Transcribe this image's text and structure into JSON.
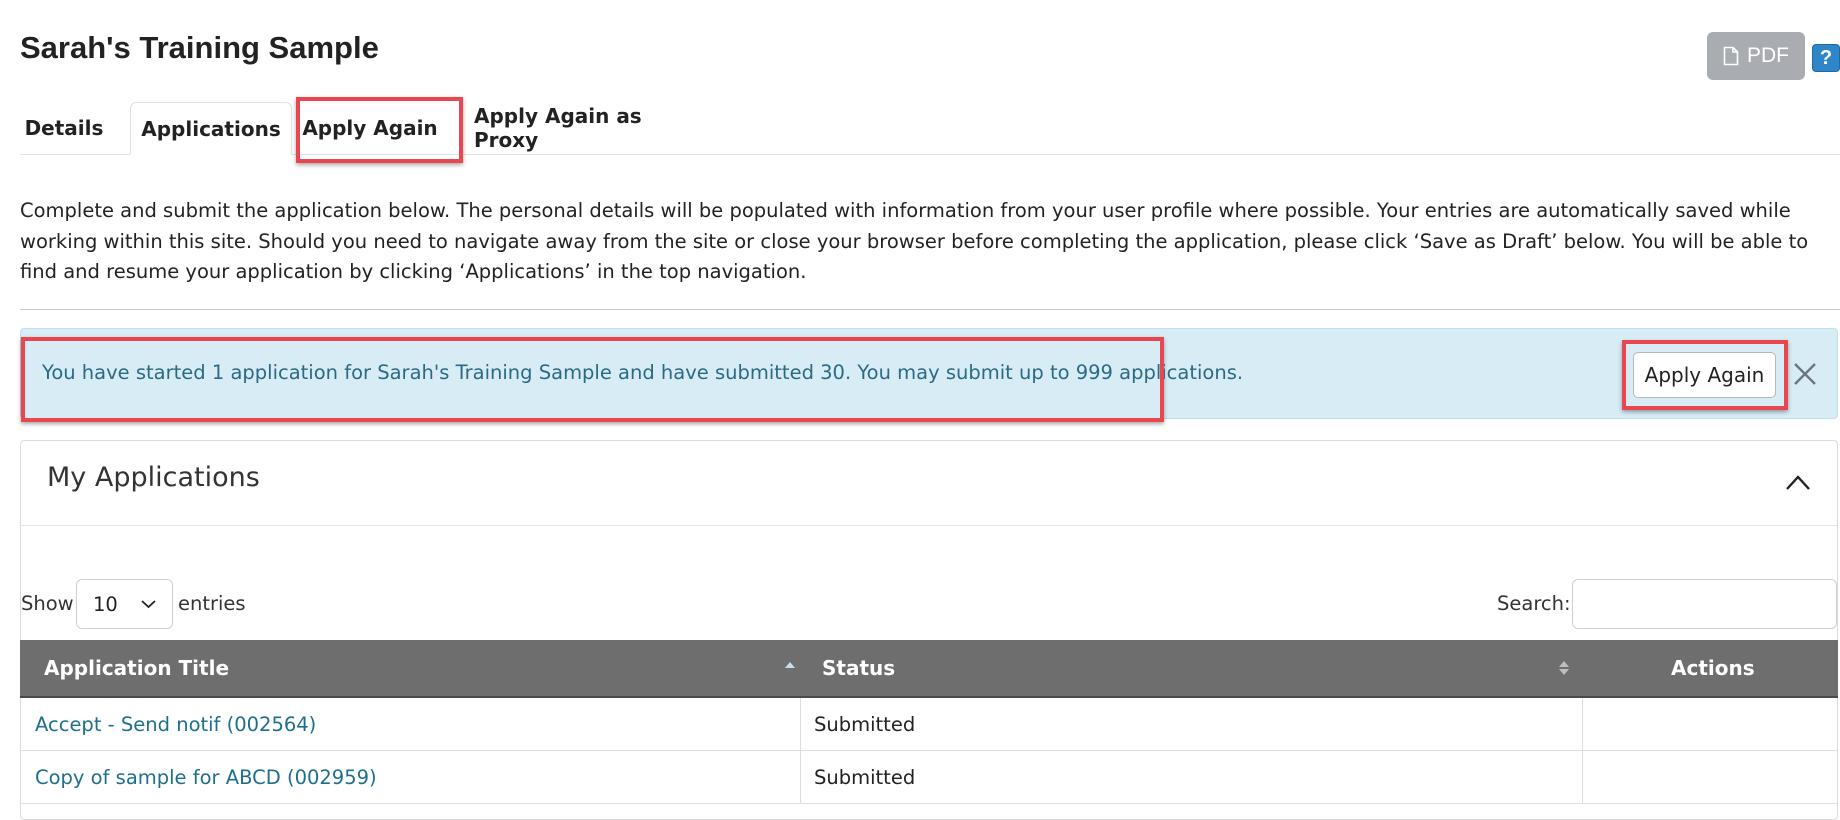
{
  "page": {
    "title": "Sarah's Training Sample",
    "pdf_label": "PDF",
    "help_label": "?"
  },
  "tabs": [
    {
      "label": "Details",
      "active": false
    },
    {
      "label": "Applications",
      "active": true
    },
    {
      "label": "Apply Again",
      "active": false,
      "highlighted": true
    },
    {
      "label": "Apply Again as Proxy",
      "active": false
    }
  ],
  "intro": {
    "text": "Complete and submit the application below. The personal details will be populated with information from your user profile where possible. Your entries are automatically saved while working within this site. Should you need to navigate away from the site or close your browser before completing the application, please click ‘Save as Draft’ below. You will be able to find and resume your application by clicking ‘Applications’ in the top navigation."
  },
  "alert": {
    "message": "You have started 1 application for Sarah's Training Sample and have submitted 30. You may submit up to 999 applications.",
    "button_label": "Apply Again",
    "highlighted": true
  },
  "panel": {
    "title": "My Applications",
    "show_label": "Show",
    "entries_label": "entries",
    "page_length": "10",
    "search_label": "Search:",
    "search_value": ""
  },
  "table": {
    "columns": [
      "Application Title",
      "Status",
      "Actions"
    ],
    "rows": [
      {
        "title": "Accept - Send notif (002564)",
        "status": "Submitted",
        "actions": ""
      },
      {
        "title": "Copy of sample for ABCD (002959)",
        "status": "Submitted",
        "actions": ""
      }
    ]
  },
  "colors": {
    "highlight": "#e8474f",
    "link": "#1e6f8c",
    "alert_bg": "#d8ecf6",
    "table_header": "#6e6e6e"
  }
}
